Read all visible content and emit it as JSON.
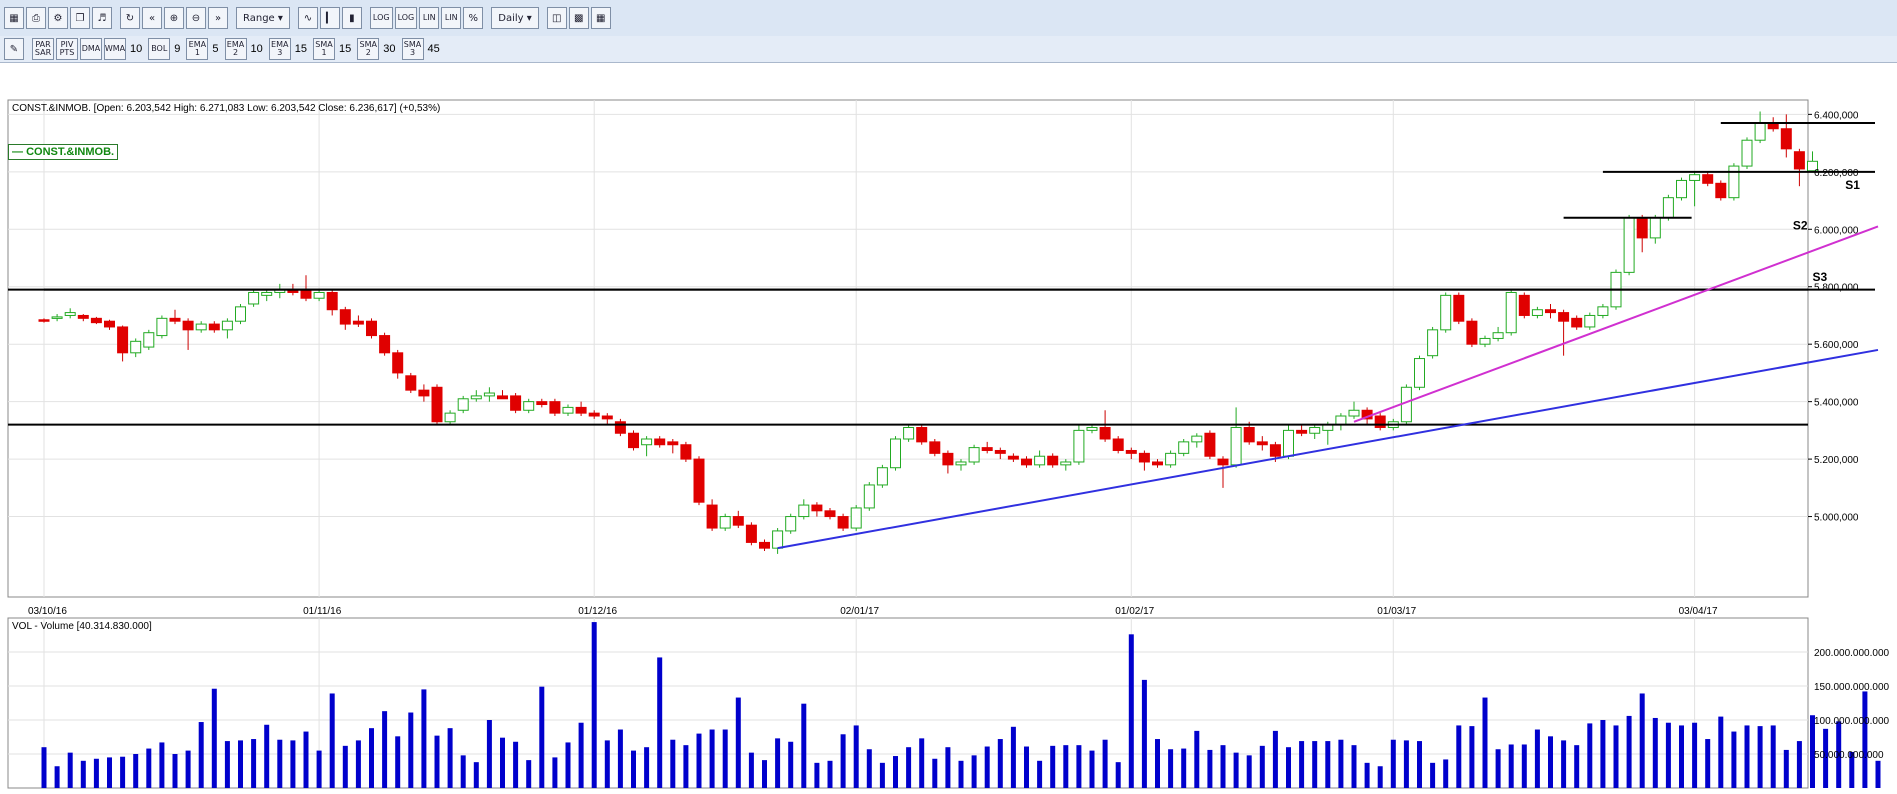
{
  "toolbar": {
    "range_label": "Range",
    "period_label": "Daily",
    "log_labels": [
      "LOG",
      "LOG",
      "LIN",
      "LIN",
      "%"
    ],
    "indicators": [
      {
        "label": "PAR SAR",
        "value": ""
      },
      {
        "label": "PIV PTS",
        "value": ""
      },
      {
        "label": "DMA",
        "value": ""
      },
      {
        "label": "WMA",
        "value": "10"
      },
      {
        "label": "BOL",
        "value": "9"
      },
      {
        "label": "EMA 1",
        "value": "5"
      },
      {
        "label": "EMA 2",
        "value": "10"
      },
      {
        "label": "EMA 3",
        "value": "15"
      },
      {
        "label": "SMA 1",
        "value": "15"
      },
      {
        "label": "SMA 2",
        "value": "30"
      },
      {
        "label": "SMA 3",
        "value": "45"
      }
    ]
  },
  "legend_tag": "CONST.&INMOB.",
  "chart_data": [
    {
      "type": "candlestick",
      "info": "CONST.&INMOB. [Open: 6.203,542  High: 6.271,083  Low: 6.203,542  Close: 6.236,617] (+0,53%)",
      "ylim": [
        4720000,
        6450000
      ],
      "y_ticks": [
        5000000,
        5200000,
        5400000,
        5600000,
        5800000,
        6000000,
        6200000,
        6400000
      ],
      "y_tick_labels": [
        "5.000,000",
        "5.200,000",
        "5.400,000",
        "5.600,000",
        "5.800,000",
        "6.000,000",
        "6.200,000",
        "6.400,000"
      ],
      "x_ticks": [
        {
          "index": 0,
          "label": "03/10/16"
        },
        {
          "index": 21,
          "label": "01/11/16"
        },
        {
          "index": 42,
          "label": "01/12/16"
        },
        {
          "index": 62,
          "label": "02/01/17"
        },
        {
          "index": 83,
          "label": "01/02/17"
        },
        {
          "index": 103,
          "label": "01/03/17"
        },
        {
          "index": 126,
          "label": "03/04/17"
        }
      ],
      "candles": [
        [
          5685000,
          5690000,
          5675000,
          5680000
        ],
        [
          5690000,
          5705000,
          5680000,
          5695000
        ],
        [
          5700000,
          5725000,
          5690000,
          5710000
        ],
        [
          5700000,
          5705000,
          5680000,
          5690000
        ],
        [
          5690000,
          5695000,
          5670000,
          5675000
        ],
        [
          5680000,
          5685000,
          5650000,
          5660000
        ],
        [
          5660000,
          5665000,
          5540000,
          5570000
        ],
        [
          5570000,
          5620000,
          5555000,
          5610000
        ],
        [
          5590000,
          5650000,
          5580000,
          5640000
        ],
        [
          5630000,
          5700000,
          5620000,
          5690000
        ],
        [
          5690000,
          5720000,
          5670000,
          5680000
        ],
        [
          5680000,
          5690000,
          5580000,
          5650000
        ],
        [
          5650000,
          5680000,
          5640000,
          5670000
        ],
        [
          5670000,
          5680000,
          5640000,
          5650000
        ],
        [
          5650000,
          5690000,
          5620000,
          5680000
        ],
        [
          5680000,
          5740000,
          5670000,
          5730000
        ],
        [
          5740000,
          5790000,
          5730000,
          5780000
        ],
        [
          5770000,
          5790000,
          5750000,
          5780000
        ],
        [
          5780000,
          5810000,
          5760000,
          5790000
        ],
        [
          5790000,
          5810000,
          5770000,
          5780000
        ],
        [
          5790000,
          5840000,
          5750000,
          5760000
        ],
        [
          5760000,
          5790000,
          5750000,
          5780000
        ],
        [
          5780000,
          5790000,
          5700000,
          5720000
        ],
        [
          5720000,
          5730000,
          5650000,
          5670000
        ],
        [
          5680000,
          5700000,
          5660000,
          5670000
        ],
        [
          5680000,
          5690000,
          5620000,
          5630000
        ],
        [
          5630000,
          5640000,
          5560000,
          5570000
        ],
        [
          5570000,
          5580000,
          5480000,
          5500000
        ],
        [
          5490000,
          5500000,
          5430000,
          5440000
        ],
        [
          5440000,
          5460000,
          5400000,
          5420000
        ],
        [
          5450000,
          5460000,
          5320000,
          5330000
        ],
        [
          5330000,
          5370000,
          5320000,
          5360000
        ],
        [
          5370000,
          5420000,
          5360000,
          5410000
        ],
        [
          5410000,
          5440000,
          5400000,
          5420000
        ],
        [
          5420000,
          5450000,
          5400000,
          5430000
        ],
        [
          5420000,
          5440000,
          5410000,
          5410000
        ],
        [
          5420000,
          5430000,
          5360000,
          5370000
        ],
        [
          5370000,
          5410000,
          5360000,
          5400000
        ],
        [
          5400000,
          5410000,
          5380000,
          5390000
        ],
        [
          5400000,
          5410000,
          5350000,
          5360000
        ],
        [
          5360000,
          5390000,
          5350000,
          5380000
        ],
        [
          5380000,
          5400000,
          5350000,
          5360000
        ],
        [
          5360000,
          5370000,
          5340000,
          5350000
        ],
        [
          5350000,
          5360000,
          5320000,
          5340000
        ],
        [
          5330000,
          5340000,
          5280000,
          5290000
        ],
        [
          5290000,
          5300000,
          5230000,
          5240000
        ],
        [
          5250000,
          5280000,
          5210000,
          5270000
        ],
        [
          5270000,
          5280000,
          5240000,
          5250000
        ],
        [
          5260000,
          5270000,
          5220000,
          5250000
        ],
        [
          5250000,
          5260000,
          5190000,
          5200000
        ],
        [
          5200000,
          5210000,
          5040000,
          5050000
        ],
        [
          5040000,
          5060000,
          4950000,
          4960000
        ],
        [
          4960000,
          5010000,
          4950000,
          5000000
        ],
        [
          5000000,
          5020000,
          4960000,
          4970000
        ],
        [
          4970000,
          4980000,
          4900000,
          4910000
        ],
        [
          4910000,
          4920000,
          4880000,
          4890000
        ],
        [
          4890000,
          4960000,
          4870000,
          4950000
        ],
        [
          4950000,
          5010000,
          4940000,
          5000000
        ],
        [
          5000000,
          5060000,
          4990000,
          5040000
        ],
        [
          5040000,
          5050000,
          5000000,
          5020000
        ],
        [
          5020000,
          5030000,
          4990000,
          5000000
        ],
        [
          5000000,
          5010000,
          4950000,
          4960000
        ],
        [
          4960000,
          5040000,
          4950000,
          5030000
        ],
        [
          5030000,
          5120000,
          5020000,
          5110000
        ],
        [
          5110000,
          5180000,
          5100000,
          5170000
        ],
        [
          5170000,
          5280000,
          5160000,
          5270000
        ],
        [
          5270000,
          5320000,
          5260000,
          5310000
        ],
        [
          5310000,
          5320000,
          5250000,
          5260000
        ],
        [
          5260000,
          5270000,
          5210000,
          5220000
        ],
        [
          5220000,
          5230000,
          5150000,
          5180000
        ],
        [
          5180000,
          5200000,
          5160000,
          5190000
        ],
        [
          5190000,
          5250000,
          5180000,
          5240000
        ],
        [
          5240000,
          5260000,
          5220000,
          5230000
        ],
        [
          5230000,
          5240000,
          5200000,
          5220000
        ],
        [
          5210000,
          5220000,
          5190000,
          5200000
        ],
        [
          5200000,
          5210000,
          5170000,
          5180000
        ],
        [
          5180000,
          5230000,
          5170000,
          5210000
        ],
        [
          5210000,
          5220000,
          5170000,
          5180000
        ],
        [
          5180000,
          5200000,
          5160000,
          5190000
        ],
        [
          5190000,
          5320000,
          5180000,
          5300000
        ],
        [
          5300000,
          5320000,
          5290000,
          5310000
        ],
        [
          5310000,
          5370000,
          5260000,
          5270000
        ],
        [
          5270000,
          5280000,
          5220000,
          5230000
        ],
        [
          5230000,
          5240000,
          5200000,
          5220000
        ],
        [
          5220000,
          5230000,
          5160000,
          5190000
        ],
        [
          5190000,
          5200000,
          5170000,
          5180000
        ],
        [
          5180000,
          5230000,
          5170000,
          5220000
        ],
        [
          5220000,
          5270000,
          5210000,
          5260000
        ],
        [
          5260000,
          5290000,
          5240000,
          5280000
        ],
        [
          5290000,
          5300000,
          5200000,
          5210000
        ],
        [
          5200000,
          5210000,
          5100000,
          5180000
        ],
        [
          5180000,
          5380000,
          5170000,
          5310000
        ],
        [
          5310000,
          5330000,
          5250000,
          5260000
        ],
        [
          5260000,
          5280000,
          5230000,
          5250000
        ],
        [
          5250000,
          5260000,
          5190000,
          5210000
        ],
        [
          5210000,
          5320000,
          5200000,
          5300000
        ],
        [
          5300000,
          5320000,
          5280000,
          5290000
        ],
        [
          5290000,
          5320000,
          5270000,
          5310000
        ],
        [
          5300000,
          5330000,
          5250000,
          5320000
        ],
        [
          5320000,
          5360000,
          5300000,
          5350000
        ],
        [
          5350000,
          5400000,
          5340000,
          5370000
        ],
        [
          5370000,
          5380000,
          5320000,
          5340000
        ],
        [
          5350000,
          5360000,
          5300000,
          5310000
        ],
        [
          5310000,
          5340000,
          5300000,
          5330000
        ],
        [
          5330000,
          5460000,
          5320000,
          5450000
        ],
        [
          5450000,
          5560000,
          5440000,
          5550000
        ],
        [
          5560000,
          5660000,
          5550000,
          5650000
        ],
        [
          5650000,
          5780000,
          5640000,
          5770000
        ],
        [
          5770000,
          5780000,
          5670000,
          5680000
        ],
        [
          5680000,
          5690000,
          5590000,
          5600000
        ],
        [
          5600000,
          5630000,
          5590000,
          5620000
        ],
        [
          5620000,
          5660000,
          5610000,
          5640000
        ],
        [
          5640000,
          5790000,
          5630000,
          5780000
        ],
        [
          5770000,
          5780000,
          5690000,
          5700000
        ],
        [
          5700000,
          5730000,
          5690000,
          5720000
        ],
        [
          5720000,
          5740000,
          5690000,
          5710000
        ],
        [
          5710000,
          5720000,
          5560000,
          5680000
        ],
        [
          5690000,
          5700000,
          5650000,
          5660000
        ],
        [
          5660000,
          5710000,
          5650000,
          5700000
        ],
        [
          5700000,
          5740000,
          5690000,
          5730000
        ],
        [
          5730000,
          5860000,
          5720000,
          5850000
        ],
        [
          5850000,
          6050000,
          5840000,
          6040000
        ],
        [
          6040000,
          6050000,
          5920000,
          5970000
        ],
        [
          5970000,
          6050000,
          5950000,
          6040000
        ],
        [
          6040000,
          6120000,
          6030000,
          6110000
        ],
        [
          6110000,
          6180000,
          6100000,
          6170000
        ],
        [
          6170000,
          6200000,
          6080000,
          6190000
        ],
        [
          6190000,
          6200000,
          6150000,
          6160000
        ],
        [
          6160000,
          6170000,
          6100000,
          6110000
        ],
        [
          6110000,
          6230000,
          6100000,
          6220000
        ],
        [
          6220000,
          6320000,
          6210000,
          6310000
        ],
        [
          6310000,
          6410000,
          6300000,
          6370000
        ],
        [
          6370000,
          6390000,
          6340000,
          6350000
        ],
        [
          6350000,
          6400000,
          6250000,
          6280000
        ],
        [
          6270000,
          6280000,
          6150000,
          6210000
        ],
        [
          6203542,
          6271083,
          6203542,
          6236617
        ]
      ],
      "h_lines": [
        5790000,
        5320000
      ],
      "segment_lines": [
        {
          "label": "S1",
          "y": 6200000,
          "from": 119,
          "to": 140
        },
        {
          "label": "S2",
          "y": 6040000,
          "from": 116,
          "to": 126
        },
        {
          "label": "S3",
          "y": 5790000,
          "from": 0,
          "to": 140
        },
        {
          "label": "",
          "y": 6370000,
          "from": 128,
          "to": 140
        }
      ],
      "trendlines": [
        {
          "color": "#3030e0",
          "from": [
            56,
            4890000
          ],
          "to": [
            140,
            5580000
          ]
        },
        {
          "color": "#d030d0",
          "from": [
            100,
            5330000
          ],
          "to": [
            140,
            6010000
          ]
        }
      ],
      "annotations": [
        {
          "text": "S1",
          "index": 137.5,
          "y": 6140000
        },
        {
          "text": "S2",
          "index": 133.5,
          "y": 6000000
        },
        {
          "text": "S3",
          "index": 135,
          "y": 5820000
        }
      ]
    },
    {
      "type": "bar",
      "info": "VOL - Volume [40.314.830.000]",
      "ylim": [
        0,
        250000000000
      ],
      "y_ticks": [
        50000000000,
        100000000000,
        150000000000,
        200000000000
      ],
      "y_tick_labels": [
        "50.000.000.000",
        "100.000.000.000",
        "150.000.000.000",
        "200.000.000.000"
      ],
      "values": [
        60000000000,
        32000000000,
        52000000000,
        40000000000,
        43000000000,
        45000000000,
        46000000000,
        50000000000,
        58000000000,
        67000000000,
        50000000000,
        55000000000,
        97000000000,
        146000000000,
        69000000000,
        70000000000,
        72000000000,
        93000000000,
        71000000000,
        70000000000,
        83000000000,
        55000000000,
        139000000000,
        62000000000,
        70000000000,
        88000000000,
        113000000000,
        76000000000,
        111000000000,
        145000000000,
        77000000000,
        88000000000,
        48000000000,
        38000000000,
        100000000000,
        74000000000,
        68000000000,
        41000000000,
        149000000000,
        45000000000,
        67000000000,
        96000000000,
        244000000000,
        70000000000,
        86000000000,
        55000000000,
        60000000000,
        192000000000,
        71000000000,
        63000000000,
        80000000000,
        86000000000,
        86000000000,
        133000000000,
        52000000000,
        41000000000,
        73000000000,
        68000000000,
        124000000000,
        37000000000,
        40000000000,
        79000000000,
        92000000000,
        57000000000,
        37000000000,
        47000000000,
        60000000000,
        73000000000,
        43000000000,
        60000000000,
        40000000000,
        48000000000,
        61000000000,
        72000000000,
        90000000000,
        61000000000,
        40000000000,
        62000000000,
        63000000000,
        63000000000,
        55000000000,
        71000000000,
        38000000000,
        226000000000,
        159000000000,
        72000000000,
        57000000000,
        58000000000,
        84000000000,
        56000000000,
        63000000000,
        52000000000,
        48000000000,
        62000000000,
        84000000000,
        60000000000,
        69000000000,
        69000000000,
        69000000000,
        71000000000,
        63000000000,
        37000000000,
        32000000000,
        71000000000,
        70000000000,
        69000000000,
        37000000000,
        42000000000,
        92000000000,
        91000000000,
        133000000000,
        57000000000,
        64000000000,
        64000000000,
        86000000000,
        76000000000,
        70000000000,
        63000000000,
        95000000000,
        100000000000,
        92000000000,
        106000000000,
        139000000000,
        103000000000,
        96000000000,
        92000000000,
        96000000000,
        72000000000,
        105000000000,
        83000000000,
        92000000000,
        91000000000,
        92000000000,
        56000000000,
        69000000000,
        107000000000,
        87000000000,
        98000000000,
        53000000000,
        142000000000,
        40000000000
      ]
    }
  ]
}
